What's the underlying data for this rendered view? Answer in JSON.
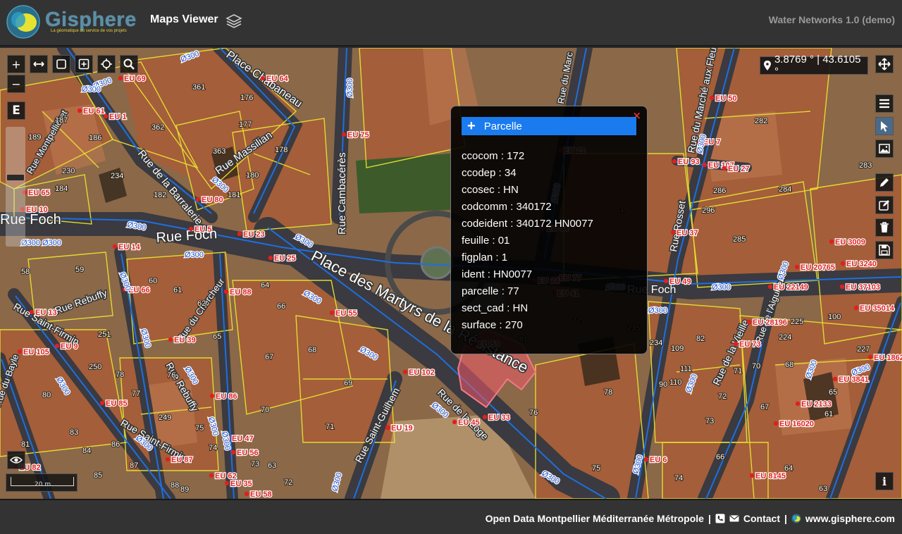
{
  "header": {
    "brand": "Gisphere",
    "tagline": "La géomatique au service de vos projets",
    "app_title": "Maps Viewer",
    "app_version": "Water Networks 1.0 (demo)"
  },
  "toolbar": {
    "zoom_in": "+",
    "zoom_out": "−",
    "edit_letter": "E"
  },
  "coordinates": {
    "text": "3.8769 ° | 43.6105 °"
  },
  "scale": {
    "label": "20 m"
  },
  "map_labels": {
    "streets": [
      "Rue Foch",
      "Rue Foch",
      "Rue Foch",
      "Place des Martyrs de la Résistance",
      "Place Chabaneau",
      "Rue de la Barralerie",
      "Rue Massilian",
      "Rue Cambacérès",
      "Rue Rebuffy",
      "Rue Saint-Firmin",
      "Rue du Chercheur",
      "Rue Saint-Guilhem",
      "Rue de la Loge",
      "Rue du Bayle",
      "Rue Montpelliéret",
      "Rue Rosset",
      "Rue de la Vieille",
      "Rue du Marché aux Fleurs",
      "Rue Rebuffy",
      "Rue Saint-Firmin",
      "Rue de l'Aiguillerie",
      "Rue du Marc"
    ],
    "parcels": [
      "187",
      "186",
      "189",
      "230",
      "184",
      "234",
      "182",
      "361",
      "362",
      "363",
      "176",
      "177",
      "178",
      "180",
      "181",
      "58",
      "59",
      "60",
      "61",
      "62",
      "64",
      "66",
      "251",
      "250",
      "78",
      "77",
      "80",
      "83",
      "81",
      "84",
      "86",
      "85",
      "87",
      "88",
      "89",
      "249",
      "76",
      "75",
      "74",
      "73",
      "72",
      "71",
      "70",
      "69",
      "68",
      "67",
      "65",
      "63",
      "229",
      "235",
      "234",
      "109",
      "111",
      "110",
      "90",
      "78",
      "75",
      "82",
      "91",
      "76",
      "1",
      "282",
      "283",
      "284",
      "286",
      "296",
      "285",
      "225",
      "100",
      "224",
      "227",
      "70",
      "71",
      "72",
      "73",
      "66",
      "67",
      "68",
      "64",
      "63",
      "65",
      "74",
      "61"
    ],
    "nodes": [
      "EU 69",
      "EU 64",
      "EU 61",
      "EU 1",
      "EU 75",
      "EU 22",
      "EU 65",
      "EU 80",
      "EU 10",
      "EU 5",
      "EU 23",
      "EU 14",
      "EU 25",
      "EU 66",
      "EU 88",
      "EU 13",
      "EU 55",
      "EU 9",
      "EU 105",
      "EU 39",
      "EU 102",
      "EU 86",
      "EU 85",
      "EU 45",
      "EU 33",
      "EU 19",
      "EU 47",
      "EU 56",
      "EU 87",
      "EU 62",
      "EU 35",
      "EU 82",
      "EU 58",
      "EU 44",
      "EU 77",
      "EU 24",
      "EU 41",
      "EU 50",
      "EU 7",
      "EU 93",
      "EU 107",
      "EU 27",
      "EU 37",
      "EU 3009",
      "EU 20765",
      "EU 3240",
      "EU 49",
      "EU 22149",
      "EU 37103",
      "EU 35014",
      "EU 28196",
      "EU 73",
      "EU 3841",
      "EU 1862",
      "EU 19",
      "EU 2133",
      "EU 16020",
      "EU 6",
      "EU 8145",
      "EU 53"
    ],
    "pipes": [
      "Ø300",
      "Ø300",
      "Ø300",
      "Ø300",
      "Ø300",
      "Ø300",
      "Ø300",
      "Ø300",
      "Ø300",
      "Ø300",
      "Ø300",
      "Ø300",
      "Ø300",
      "Ø300",
      "Ø300",
      "Ø300",
      "Ø300",
      "Ø300",
      "Ø300",
      "Ø300",
      "Ø300",
      "Ø300",
      "Ø300",
      "Ø300",
      "Ø300",
      "Ø300",
      "Ø300",
      "Ø300",
      "Ø300",
      "Ø300",
      "Ø300",
      "Ø300"
    ]
  },
  "popup": {
    "title": "Parcelle",
    "close": "×",
    "fields": [
      "ccocom : 172",
      "ccodep : 34",
      "ccosec : HN",
      "codcomm : 340172",
      "codeident : 340172 HN0077",
      "feuille : 01",
      "figplan : 1",
      "ident : HN0077",
      "parcelle : 77",
      "sect_cad : HN",
      "surface : 270"
    ]
  },
  "footer": {
    "open_data": "Open Data Montpellier Méditerranée Métropole",
    "sep1": "|",
    "contact": "Contact",
    "sep2": "|",
    "website": "www.gisphere.com"
  },
  "colors": {
    "header_bg": "#333333",
    "popup_head": "#1a7bef",
    "parcel_line": "#e8e030",
    "pipe_line": "#1e6fe0",
    "node_label": "#e02020",
    "selected_parcel": "#f05a6a"
  }
}
